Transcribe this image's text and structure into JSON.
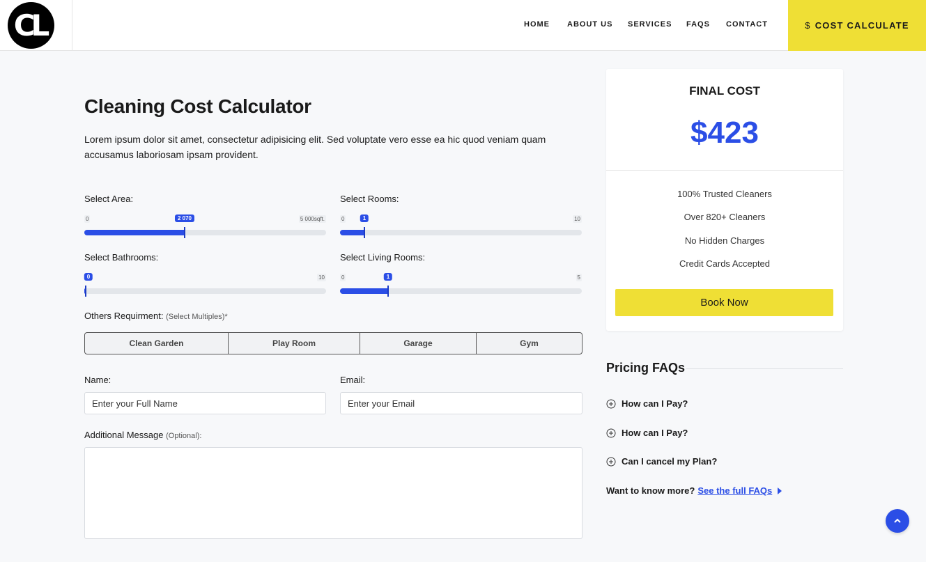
{
  "header": {
    "logo_text": "CL",
    "nav": [
      "HOME",
      "ABOUT US",
      "SERVICES",
      "FAQS",
      "CONTACT"
    ],
    "cta_icon": "dollar-icon",
    "cta_label": "COST CALCULATE"
  },
  "main": {
    "title": "Cleaning Cost Calculator",
    "intro": "Lorem ipsum dolor sit amet, consectetur adipisicing elit. Sed voluptate vero esse ea hic quod veniam quam accusamus laboriosam ipsam provident.",
    "sliders": {
      "area": {
        "label": "Select Area:",
        "min": "0",
        "max": "5 000sqft.",
        "value": "2 070",
        "fraction": 0.414
      },
      "rooms": {
        "label": "Select Rooms:",
        "min": "0",
        "max": "10",
        "value": "1",
        "fraction": 0.1
      },
      "bathrooms": {
        "label": "Select Bathrooms:",
        "min": "0",
        "max": "10",
        "value": "0",
        "fraction": 0.0
      },
      "living": {
        "label": "Select Living Rooms:",
        "min": "0",
        "max": "5",
        "value": "1",
        "fraction": 0.2
      }
    },
    "others": {
      "label": "Others Requirment:",
      "sub": "(Select Multiples)*",
      "options": [
        "Clean Garden",
        "Play Room",
        "Garage",
        "Gym"
      ]
    },
    "form": {
      "name_label": "Name:",
      "name_placeholder": "Enter your Full Name",
      "email_label": "Email:",
      "email_placeholder": "Enter your Email",
      "message_label": "Additional Message",
      "message_sub": "(Optional):"
    }
  },
  "sidebar": {
    "final_label": "FINAL COST",
    "final_value": "$423",
    "features": [
      "100% Trusted Cleaners",
      "Over 820+ Cleaners",
      "No Hidden Charges",
      "Credit Cards Accepted"
    ],
    "book_label": "Book Now",
    "faq_title": "Pricing FAQs",
    "faqs": [
      "How can I Pay?",
      "How can I Pay?",
      "Can I cancel my Plan?"
    ],
    "more_text": "Want to know more?",
    "more_link": "See the full FAQs"
  },
  "colors": {
    "accent": "#2b4ee6",
    "cta": "#efdf35"
  }
}
